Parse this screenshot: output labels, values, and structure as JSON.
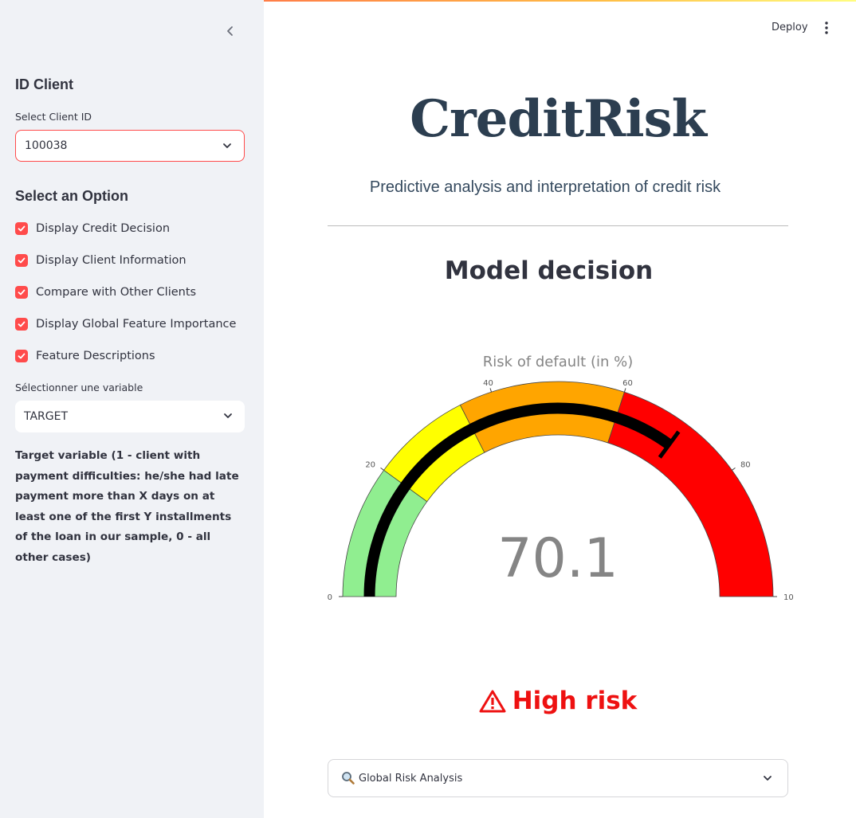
{
  "header": {
    "deploy_label": "Deploy",
    "menu_icon": "kebab-menu-icon"
  },
  "sidebar": {
    "collapse_icon": "chevron-left-icon",
    "id_heading": "ID Client",
    "client_select_label": "Select Client ID",
    "client_select_value": "100038",
    "options_heading": "Select an Option",
    "options": [
      {
        "label": "Display Credit Decision",
        "checked": true
      },
      {
        "label": "Display Client Information",
        "checked": true
      },
      {
        "label": "Compare with Other Clients",
        "checked": true
      },
      {
        "label": "Display Global Feature Importance",
        "checked": true
      },
      {
        "label": "Feature Descriptions",
        "checked": true
      }
    ],
    "variable_select_label": "Sélectionner une variable",
    "variable_select_value": "TARGET",
    "variable_description": "Target variable (1 - client with payment difficulties: he/she had late payment more than X days on at least one of the first Y installments of the loan in our sample, 0 - all other cases)"
  },
  "main": {
    "title": "CreditRisk",
    "subtitle": "Predictive analysis and interpretation of credit risk",
    "section_heading": "Model decision",
    "gauge": {
      "title": "Risk of default (in %)",
      "value": 70.1,
      "value_text": "70.1",
      "min": 0,
      "max": 100,
      "tick_labels": [
        "0",
        "20",
        "40",
        "60",
        "80",
        "10"
      ],
      "bands": [
        {
          "from": 0,
          "to": 20,
          "color": "#90ee90"
        },
        {
          "from": 20,
          "to": 35,
          "color": "#ffff00"
        },
        {
          "from": 35,
          "to": 60,
          "color": "#ffa500"
        },
        {
          "from": 60,
          "to": 100,
          "color": "#ff0000"
        }
      ],
      "bar_color": "#000000"
    },
    "risk_label": "High risk",
    "risk_icon": "warning-icon",
    "risk_color": "#ee1111",
    "expander": {
      "label": "Global Risk Analysis",
      "icon": "magnifier-icon"
    }
  }
}
